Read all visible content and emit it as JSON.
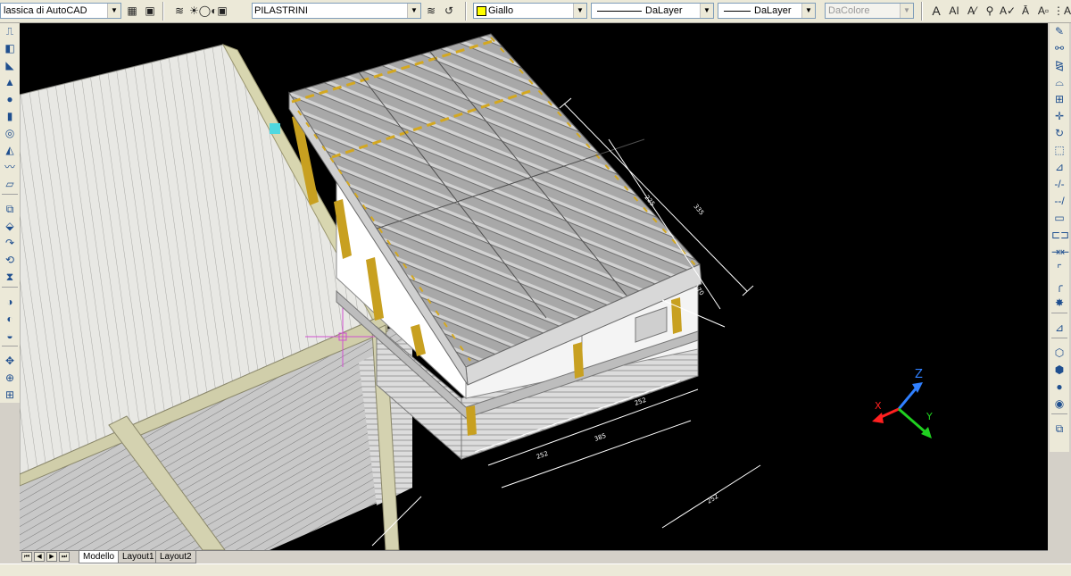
{
  "toolbar": {
    "workspace": "lassica di AutoCAD",
    "layer": "PILASTRINI",
    "color": "Giallo",
    "color_swatch": "#ffff00",
    "linetype": "DaLayer",
    "lineweight": "DaLayer",
    "plotstyle": "DaColore"
  },
  "tabs": [
    "Modello",
    "Layout1",
    "Layout2"
  ],
  "active_tab": "Modello",
  "dimensions": [
    "225",
    "170",
    "335",
    "252",
    "385",
    "252",
    "252"
  ],
  "ucs": {
    "x_label": "X",
    "y_label": "Y",
    "z_label": "Z"
  },
  "colors": {
    "background": "#000000",
    "accent_yellow": "#c8a020",
    "axis_x": "#ff2020",
    "axis_y": "#20ff20",
    "axis_z": "#3080ff"
  }
}
